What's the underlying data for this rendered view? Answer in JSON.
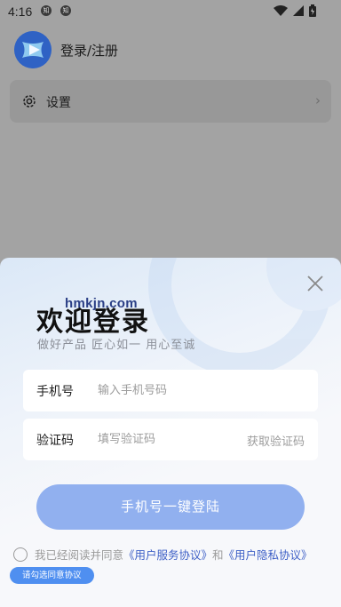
{
  "status_bar": {
    "time": "4:16",
    "notif_1": "知",
    "notif_2": "知"
  },
  "profile": {
    "name": "登录/注册"
  },
  "settings": {
    "label": "设置",
    "chevron": "›"
  },
  "login_sheet": {
    "watermark": "hmkjn.com",
    "title": "欢迎登录",
    "subtitle": "做好产品 匠心如一 用心至诚",
    "phone": {
      "label": "手机号",
      "placeholder": "输入手机号码",
      "value": ""
    },
    "code": {
      "label": "验证码",
      "placeholder": "填写验证码",
      "value": "",
      "get_code": "获取验证码"
    },
    "submit": "手机号一键登陆",
    "agreement": {
      "prefix": "我已经阅读并同意",
      "service_link": "《用户服务协议》",
      "conj": "和",
      "privacy_link": "《用户隐私协议》"
    },
    "toast": "请勾选同意协议"
  },
  "colors": {
    "accent": "#91b0ef",
    "link": "#3d5fc6",
    "toast": "#4f8ff0"
  }
}
